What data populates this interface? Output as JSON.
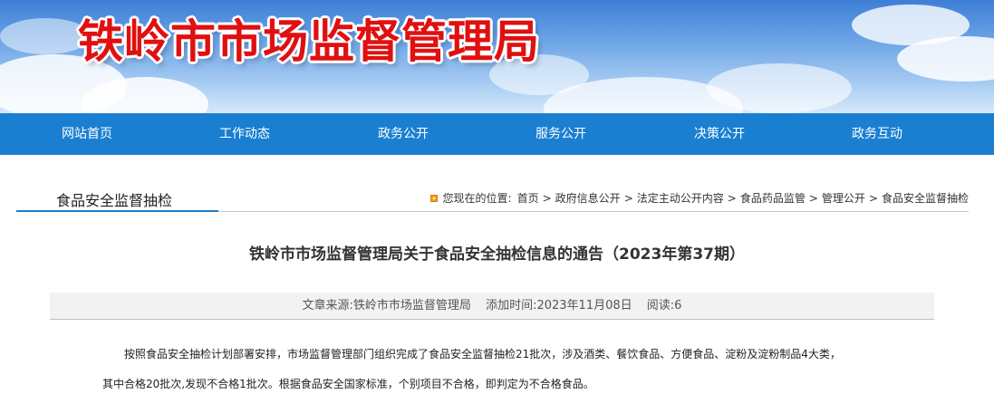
{
  "header": {
    "site_title": "铁岭市市场监督管理局"
  },
  "nav": {
    "items": [
      {
        "label": "网站首页"
      },
      {
        "label": "工作动态"
      },
      {
        "label": "政务公开"
      },
      {
        "label": "服务公开"
      },
      {
        "label": "决策公开"
      },
      {
        "label": "政务互动"
      }
    ]
  },
  "section": {
    "title": "食品安全监督抽检"
  },
  "breadcrumb": {
    "prefix": "您现在的位置:",
    "items": [
      {
        "label": "首页"
      },
      {
        "label": "政府信息公开"
      },
      {
        "label": "法定主动公开内容"
      },
      {
        "label": "食品药品监管"
      },
      {
        "label": "管理公开"
      },
      {
        "label": "食品安全监督抽检"
      }
    ],
    "separator": ">"
  },
  "article": {
    "title": "铁岭市市场监督管理局关于食品安全抽检信息的通告（2023年第37期）",
    "source": "文章来源:铁岭市市场监督管理局",
    "added_time": "添加时间:2023年11月08日",
    "reads": "阅读:6",
    "paragraph_line1": "按照食品安全抽检计划部署安排，市场监督管理部门组织完成了食品安全监督抽检21批次，涉及酒类、餐饮食品、方便食品、淀粉及淀粉制品4大类，",
    "paragraph_line2": "其中合格20批次,发现不合格1批次。根据食品安全国家标准，个别项目不合格，即判定为不合格食品。"
  }
}
